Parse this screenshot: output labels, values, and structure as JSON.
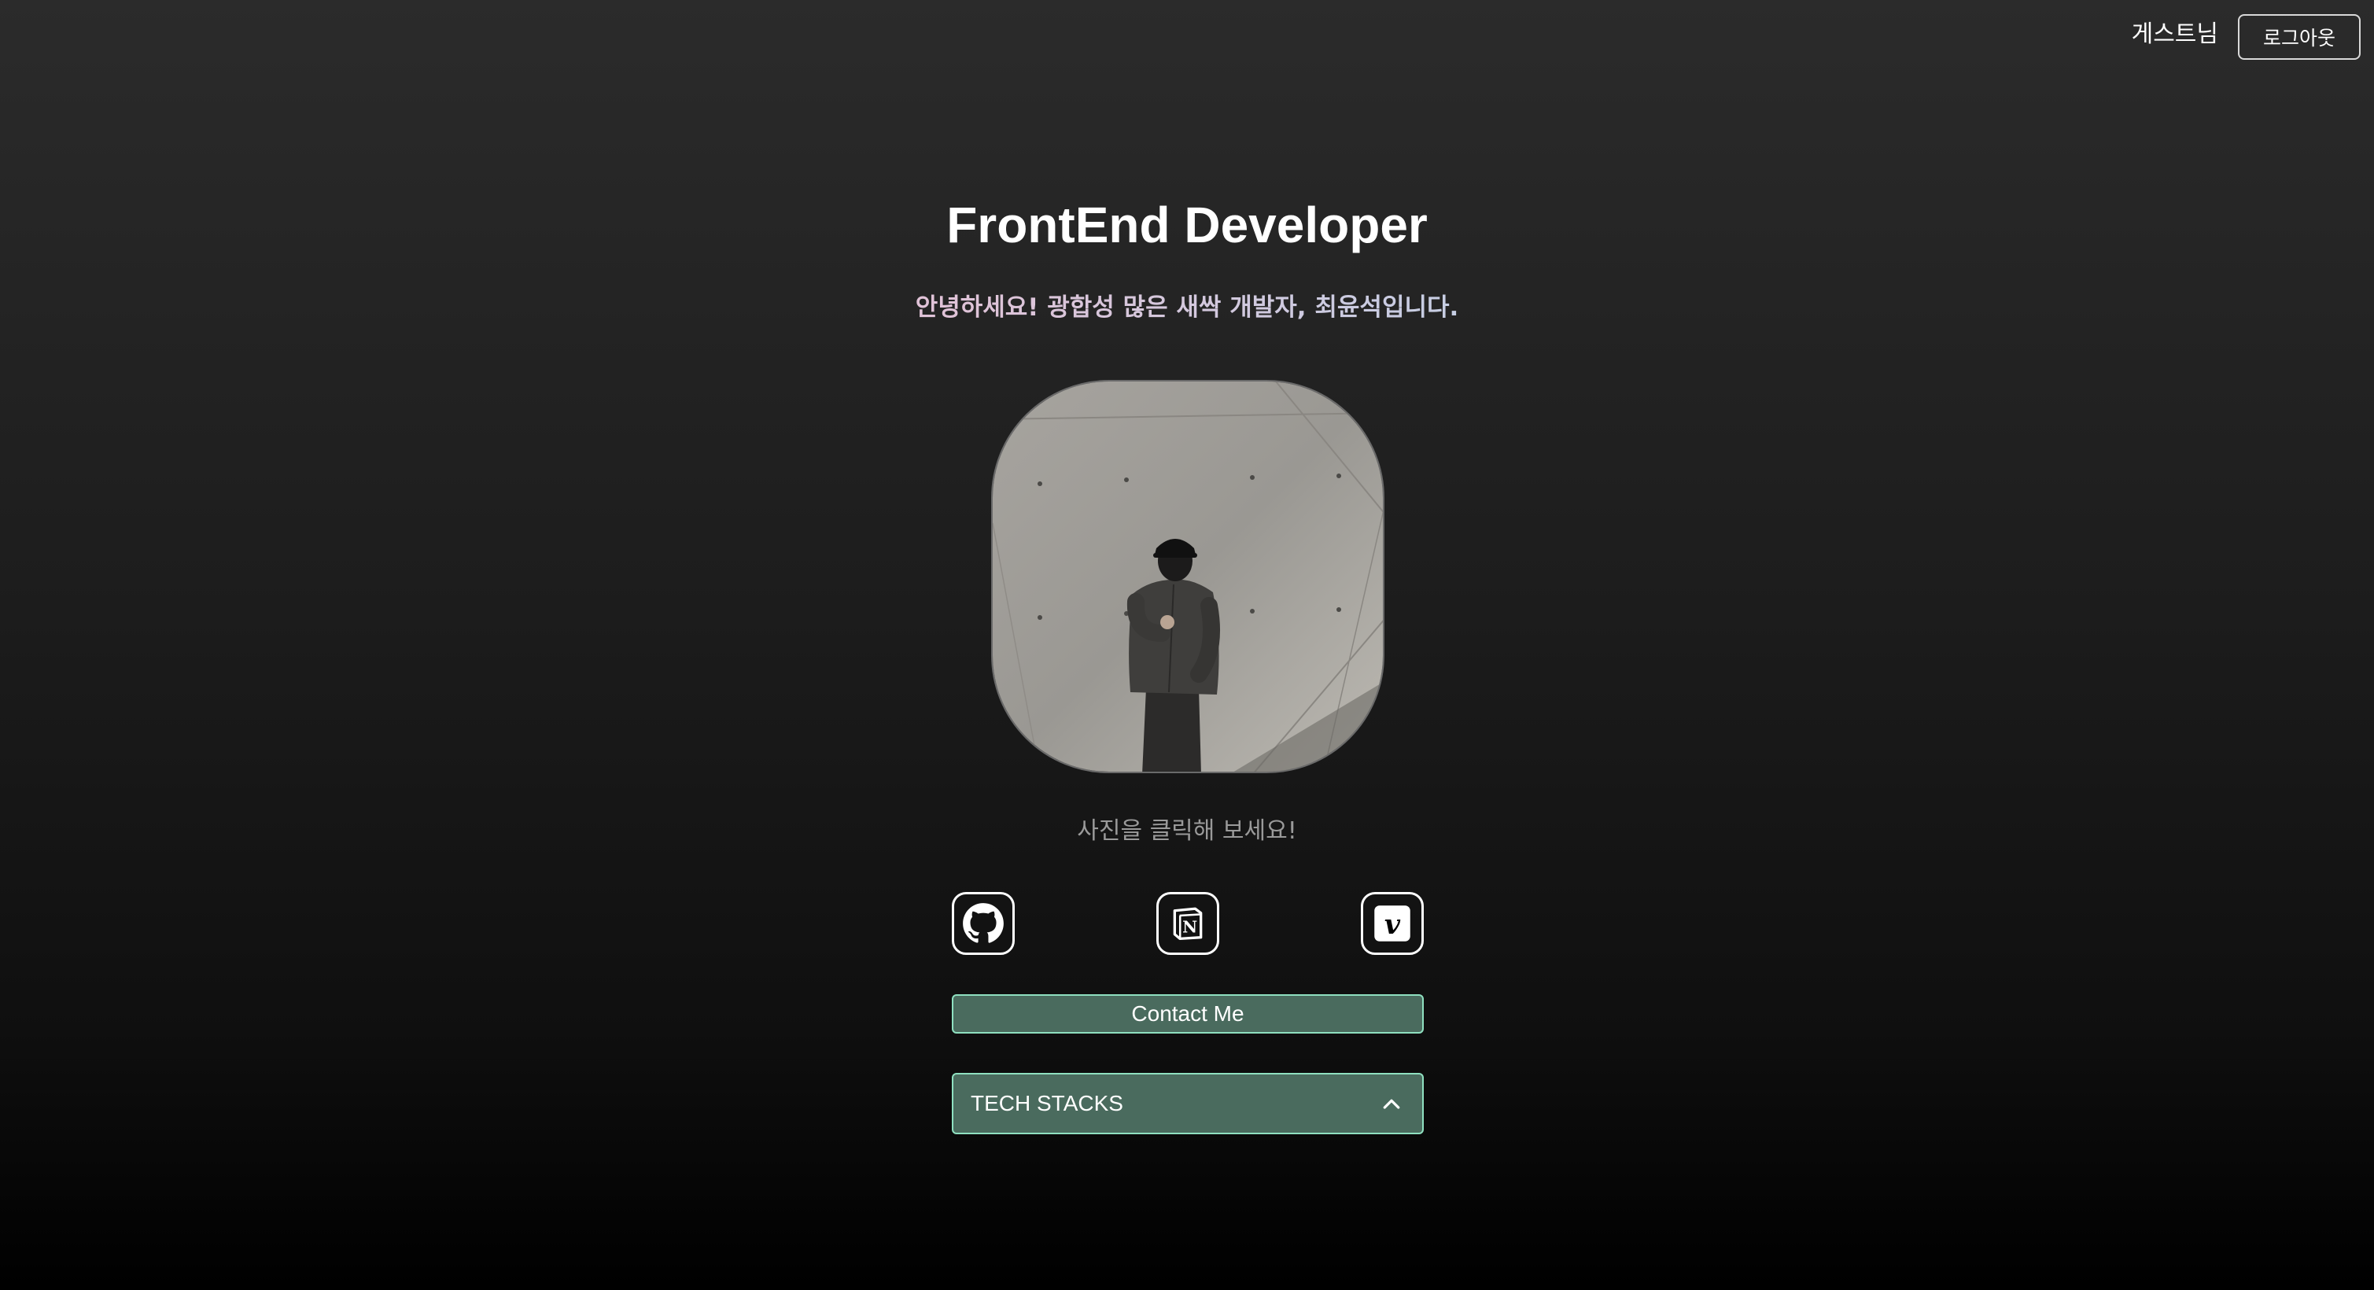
{
  "header": {
    "user_name": "게스트님",
    "logout_label": "로그아웃"
  },
  "hero": {
    "title": "FrontEnd Developer",
    "subtitle": "안녕하세요! 광합성 많은 새싹 개발자, 최윤석입니다.",
    "photo_icon": "profile-photo",
    "photo_hint": "사진을 클릭해 보세요!"
  },
  "social": [
    {
      "icon": "github-icon"
    },
    {
      "icon": "notion-icon"
    },
    {
      "icon": "velog-icon"
    }
  ],
  "contact": {
    "label": "Contact Me"
  },
  "tech_stacks": {
    "label": "TECH STACKS",
    "icon": "chevron-up-icon"
  },
  "colors": {
    "button_bg": "#4a6b5e",
    "button_border": "#8fe0c0",
    "subtitle_gradient_start": "#f4b8c8",
    "subtitle_gradient_end": "#9cc8ec"
  }
}
